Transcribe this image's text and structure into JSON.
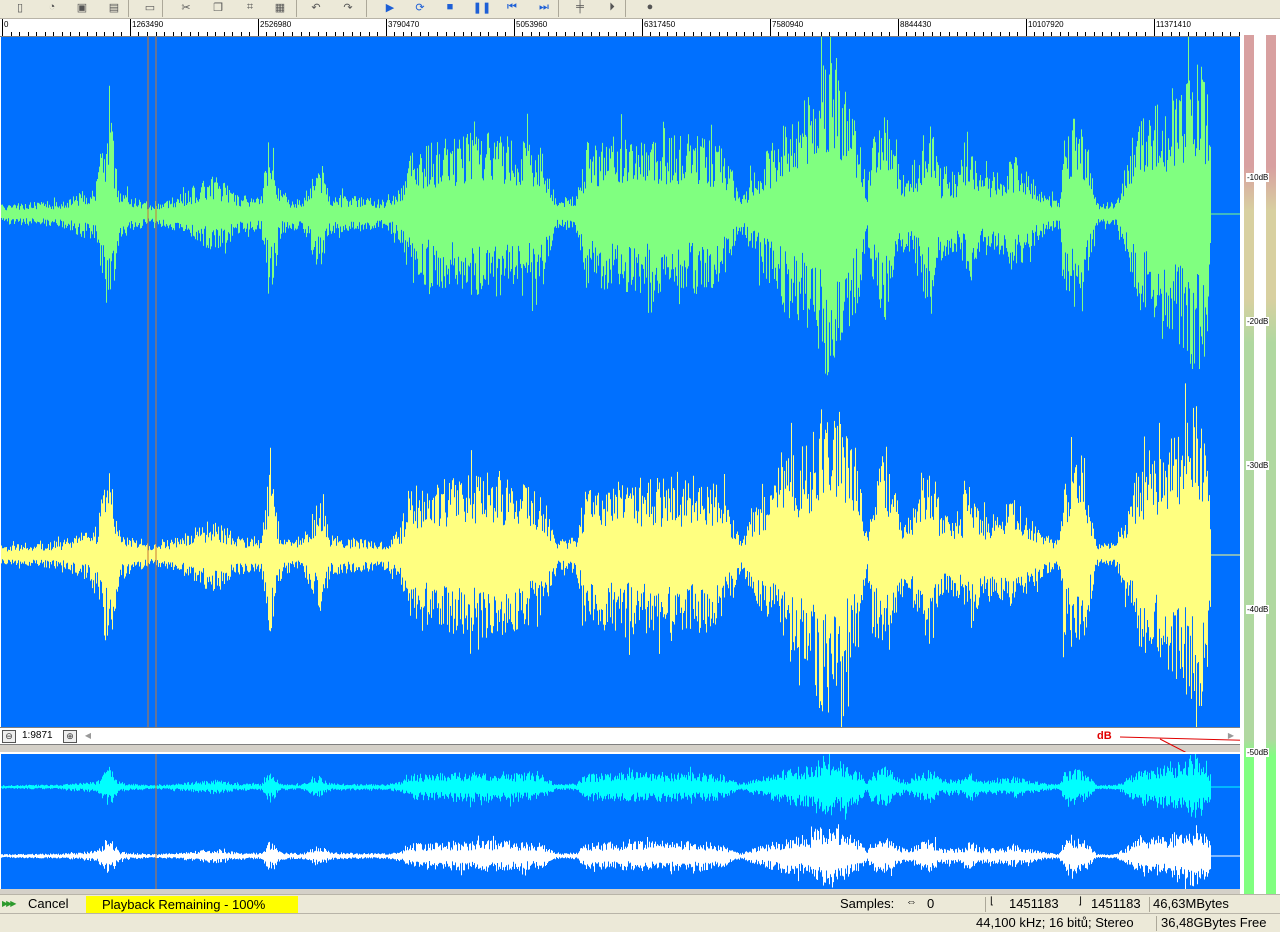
{
  "toolbar": {
    "buttons": [
      {
        "name": "new-file-icon",
        "glyph": "▯"
      },
      {
        "name": "open-folder-icon",
        "glyph": "◔"
      },
      {
        "name": "save-icon",
        "glyph": "▣"
      },
      {
        "name": "save-all-icon",
        "glyph": "▤"
      },
      {
        "name": "copy-to-file-icon",
        "glyph": "▭"
      },
      {
        "name": "cut-icon",
        "glyph": "✂"
      },
      {
        "name": "copy-icon",
        "glyph": "❐"
      },
      {
        "name": "crop-icon",
        "glyph": "⌗"
      },
      {
        "name": "paste-icon",
        "glyph": "▦"
      },
      {
        "name": "undo-icon",
        "glyph": "↶"
      },
      {
        "name": "redo-icon",
        "glyph": "↷"
      },
      {
        "name": "play-icon",
        "glyph": "▶"
      },
      {
        "name": "play-looped-icon",
        "glyph": "⟳"
      },
      {
        "name": "stop-icon",
        "glyph": "■"
      },
      {
        "name": "pause-icon",
        "glyph": "❚❚"
      },
      {
        "name": "rewind-icon",
        "glyph": "⏮"
      },
      {
        "name": "forward-icon",
        "glyph": "⏭"
      },
      {
        "name": "marker-icon",
        "glyph": "╪"
      },
      {
        "name": "end-marker-icon",
        "glyph": "⏵"
      },
      {
        "name": "record-icon",
        "glyph": "●"
      }
    ]
  },
  "ruler": {
    "labels": [
      "0",
      "1263490",
      "2526980",
      "3790470",
      "5053960",
      "6317450",
      "7580940",
      "8844430",
      "10107920",
      "11371410"
    ]
  },
  "zoom": {
    "zoom_out_label": "⊖",
    "ratio": "1:9871",
    "zoom_in_label": "⊕"
  },
  "vu_meter": {
    "labels": [
      "-10dB",
      "-20dB",
      "-30dB",
      "-40dB",
      "-50dB"
    ],
    "db_indicator": "dB"
  },
  "status": {
    "cancel_label": "Cancel",
    "playback_remaining": "Playback Remaining - 100%",
    "samples_label": "Samples:",
    "samples_value": "0",
    "selection_start": "1451183",
    "selection_end": "1451183",
    "memory": "46,63MBytes",
    "format": "44,100 kHz; 16 bitů; Stereo",
    "disk_free": "36,48GBytes Free"
  },
  "colors": {
    "waveform_background": "#0070ff",
    "channel_left": "#80ff80",
    "channel_right": "#ffff80",
    "overview_left": "#00ffff",
    "overview_right": "#ffffff",
    "cursor_line": "#c87832",
    "playback_highlight": "#ffff00"
  }
}
